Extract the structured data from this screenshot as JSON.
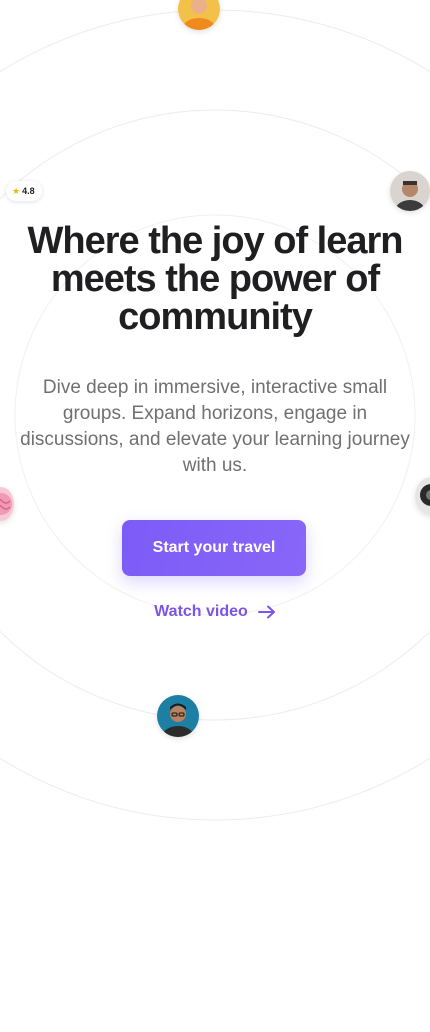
{
  "rating": {
    "value": "4.8",
    "icon": "star-icon"
  },
  "hero": {
    "headline": "Where the joy of learn meets the power of community",
    "subtext": "Dive deep in immersive, interactive small groups. Expand horizons, engage in discussions, and elevate your learning journey with us."
  },
  "actions": {
    "primary_label": "Start your travel",
    "secondary_label": "Watch video",
    "secondary_icon": "arrow-right-icon"
  },
  "colors": {
    "accent": "#7c5cf7",
    "link": "#7c55e8",
    "headline": "#1f1f21",
    "subtext": "#707070"
  }
}
